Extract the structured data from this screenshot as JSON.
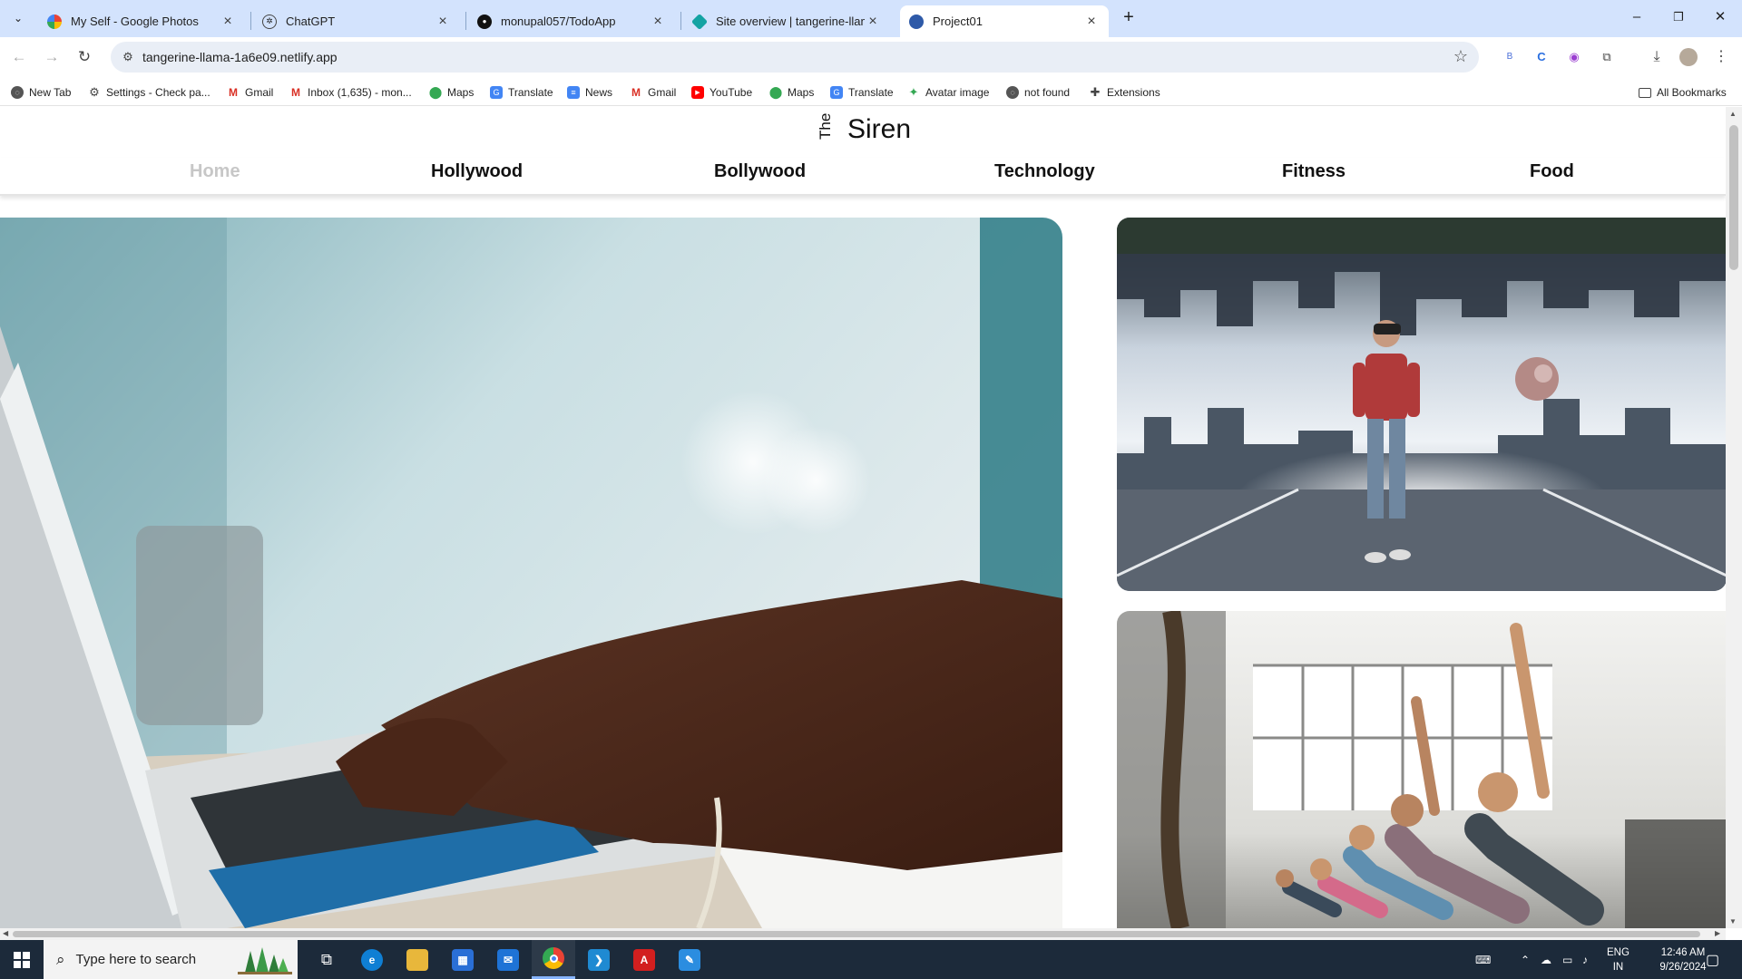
{
  "browser": {
    "tabs": [
      {
        "title": "My Self - Google Photos",
        "icon": "google-photos-icon",
        "color": "#fbbc04"
      },
      {
        "title": "ChatGPT",
        "icon": "chatgpt-icon",
        "color": "#444444"
      },
      {
        "title": "monupal057/TodoApp",
        "icon": "github-icon",
        "color": "#111111"
      },
      {
        "title": "Site overview | tangerine-llam",
        "icon": "netlify-icon",
        "color": "#14a3a3"
      },
      {
        "title": "Project01",
        "icon": "site-favicon-icon",
        "color": "#2e5aa8",
        "active": true
      }
    ],
    "url": "tangerine-llama-1a6e09.netlify.app",
    "bookmarks": [
      {
        "label": "New Tab",
        "icon": "globe-icon",
        "color": "#555555"
      },
      {
        "label": "Settings - Check pa...",
        "icon": "gear-icon",
        "color": "#555555"
      },
      {
        "label": "Gmail",
        "icon": "gmail-icon",
        "color": "#d93025"
      },
      {
        "label": "Inbox (1,635) - mon...",
        "icon": "gmail-icon",
        "color": "#d93025"
      },
      {
        "label": "Maps",
        "icon": "maps-icon",
        "color": "#34a853"
      },
      {
        "label": "Translate",
        "icon": "translate-icon",
        "color": "#4285f4"
      },
      {
        "label": "News",
        "icon": "news-icon",
        "color": "#4285f4"
      },
      {
        "label": "Gmail",
        "icon": "gmail-icon",
        "color": "#d93025"
      },
      {
        "label": "YouTube",
        "icon": "youtube-icon",
        "color": "#ff0000"
      },
      {
        "label": "Maps",
        "icon": "maps-icon",
        "color": "#34a853"
      },
      {
        "label": "Translate",
        "icon": "translate-icon",
        "color": "#4285f4"
      },
      {
        "label": "Avatar image",
        "icon": "avatar-icon",
        "color": "#34a853"
      },
      {
        "label": "not found",
        "icon": "globe-icon",
        "color": "#555555"
      },
      {
        "label": "Extensions",
        "icon": "puzzle-icon",
        "color": "#555555"
      }
    ],
    "all_bookmarks": "All Bookmarks"
  },
  "site": {
    "logo_small": "The",
    "logo_main": "Siren",
    "nav": [
      {
        "label": "Home",
        "active": true
      },
      {
        "label": "Hollywood"
      },
      {
        "label": "Bollywood"
      },
      {
        "label": "Technology"
      },
      {
        "label": "Fitness"
      },
      {
        "label": "Food"
      }
    ],
    "images": [
      {
        "subject": "hands typing on laptop"
      },
      {
        "subject": "man with VR headset in inverted city"
      },
      {
        "subject": "group fitness class stretching"
      }
    ]
  },
  "taskbar": {
    "search_placeholder": "Type here to search",
    "apps": [
      {
        "name": "task-view-icon",
        "glyph": "⧉",
        "color": "#1c2a3a"
      },
      {
        "name": "edge-icon",
        "glyph": "e",
        "color": "#0f7fd4"
      },
      {
        "name": "file-explorer-icon",
        "glyph": "▬",
        "color": "#e8b73b"
      },
      {
        "name": "store-icon",
        "glyph": "▦",
        "color": "#2a6fd6"
      },
      {
        "name": "mail-icon",
        "glyph": "✉",
        "color": "#1e73d6"
      },
      {
        "name": "chrome-icon",
        "glyph": "◉",
        "color": "#dd4b39",
        "active": true
      },
      {
        "name": "vscode-icon",
        "glyph": "❯",
        "color": "#1f8ad2"
      },
      {
        "name": "acrobat-icon",
        "glyph": "A",
        "color": "#d21f1f"
      },
      {
        "name": "paint-icon",
        "glyph": "✎",
        "color": "#2b8de0"
      }
    ],
    "lang_top": "ENG",
    "lang_bottom": "IN",
    "time": "12:46 AM",
    "date": "9/26/2024"
  }
}
